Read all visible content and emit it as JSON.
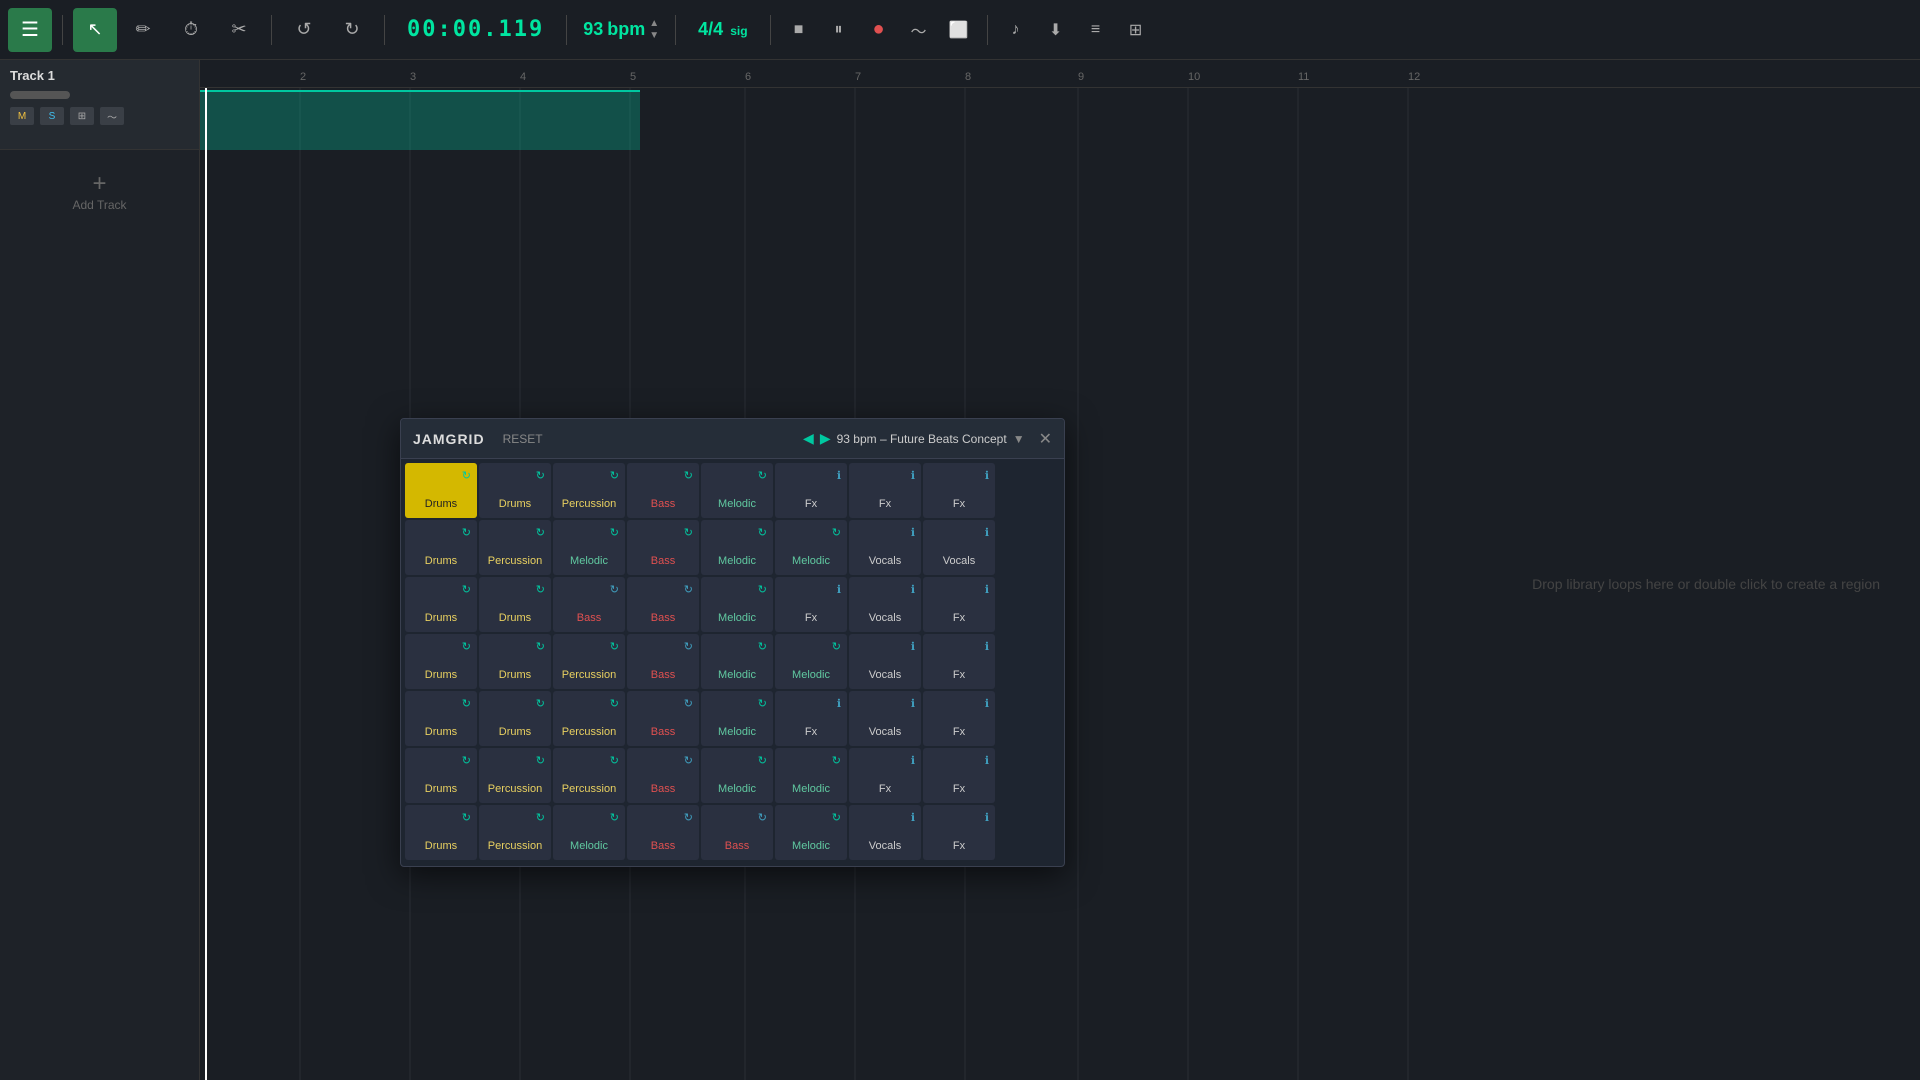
{
  "toolbar": {
    "menu_icon": "☰",
    "cursor_icon": "↖",
    "pencil_icon": "✏",
    "clock_icon": "⏱",
    "scissors_icon": "✂",
    "undo_icon": "↺",
    "redo_icon": "↻",
    "timecode": "00:00.119",
    "bpm_value": "93",
    "bpm_label": "bpm",
    "sig_value": "4/4",
    "sig_label": "sig",
    "stop_icon": "■",
    "play_icon": "⏸",
    "record_icon": "●",
    "waveform_icon": "〜",
    "loop_icon": "⬜",
    "browse_icon": "🎵",
    "import_icon": "⬇",
    "grid_icon": "⊞",
    "effects_icon": "⊞"
  },
  "track_list": {
    "tracks": [
      {
        "name": "Track 1",
        "mute_label": "M",
        "solo_label": "S"
      }
    ],
    "add_track_label": "Add Track"
  },
  "ruler": {
    "marks": [
      "2",
      "3",
      "4",
      "5",
      "6",
      "7",
      "8",
      "9",
      "10",
      "11",
      "12"
    ]
  },
  "drop_hint": "Drop library loops here or double click to create a region",
  "jamgrid": {
    "title": "JAMGRID",
    "reset_label": "RESET",
    "bpm_song": "93 bpm – Future Beats Concept",
    "close_icon": "✕",
    "rows": [
      [
        {
          "label": "Drums",
          "type": "drums",
          "icon_type": "green",
          "active": true
        },
        {
          "label": "Drums",
          "type": "drums",
          "icon_type": "green",
          "active": false
        },
        {
          "label": "Percussion",
          "type": "percussion",
          "icon_type": "green",
          "active": false
        },
        {
          "label": "Bass",
          "type": "bass",
          "icon_type": "green",
          "active": false
        },
        {
          "label": "Melodic",
          "type": "melodic",
          "icon_type": "green",
          "active": false
        },
        {
          "label": "Fx",
          "type": "fx",
          "icon_type": "info",
          "active": false
        },
        {
          "label": "Fx",
          "type": "fx",
          "icon_type": "info",
          "active": false
        },
        {
          "label": "Fx",
          "type": "fx",
          "icon_type": "info",
          "active": false
        }
      ],
      [
        {
          "label": "Drums",
          "type": "drums",
          "icon_type": "green",
          "active": false
        },
        {
          "label": "Percussion",
          "type": "percussion",
          "icon_type": "green",
          "active": false
        },
        {
          "label": "Melodic",
          "type": "melodic",
          "icon_type": "green",
          "active": false
        },
        {
          "label": "Bass",
          "type": "bass",
          "icon_type": "green",
          "active": false
        },
        {
          "label": "Melodic",
          "type": "melodic",
          "icon_type": "green",
          "active": false
        },
        {
          "label": "Melodic",
          "type": "melodic",
          "icon_type": "green",
          "active": false
        },
        {
          "label": "Vocals",
          "type": "vocals",
          "icon_type": "info",
          "active": false
        },
        {
          "label": "Vocals",
          "type": "vocals",
          "icon_type": "info",
          "active": false
        }
      ],
      [
        {
          "label": "Drums",
          "type": "drums",
          "icon_type": "green",
          "active": false
        },
        {
          "label": "Drums",
          "type": "drums",
          "icon_type": "green",
          "active": false
        },
        {
          "label": "Bass",
          "type": "bass",
          "icon_type": "teal",
          "active": false
        },
        {
          "label": "Bass",
          "type": "bass",
          "icon_type": "teal",
          "active": false
        },
        {
          "label": "Melodic",
          "type": "melodic",
          "icon_type": "green",
          "active": false
        },
        {
          "label": "Fx",
          "type": "fx",
          "icon_type": "info",
          "active": false
        },
        {
          "label": "Vocals",
          "type": "vocals",
          "icon_type": "info",
          "active": false
        },
        {
          "label": "Fx",
          "type": "fx",
          "icon_type": "info",
          "active": false
        }
      ],
      [
        {
          "label": "Drums",
          "type": "drums",
          "icon_type": "green",
          "active": false
        },
        {
          "label": "Drums",
          "type": "drums",
          "icon_type": "green",
          "active": false
        },
        {
          "label": "Percussion",
          "type": "percussion",
          "icon_type": "green",
          "active": false
        },
        {
          "label": "Bass",
          "type": "bass",
          "icon_type": "teal",
          "active": false
        },
        {
          "label": "Melodic",
          "type": "melodic",
          "icon_type": "green",
          "active": false
        },
        {
          "label": "Melodic",
          "type": "melodic",
          "icon_type": "green",
          "active": false
        },
        {
          "label": "Vocals",
          "type": "vocals",
          "icon_type": "info",
          "active": false
        },
        {
          "label": "Fx",
          "type": "fx",
          "icon_type": "info",
          "active": false
        }
      ],
      [
        {
          "label": "Drums",
          "type": "drums",
          "icon_type": "green",
          "active": false
        },
        {
          "label": "Drums",
          "type": "drums",
          "icon_type": "green",
          "active": false
        },
        {
          "label": "Percussion",
          "type": "percussion",
          "icon_type": "green",
          "active": false
        },
        {
          "label": "Bass",
          "type": "bass",
          "icon_type": "teal",
          "active": false
        },
        {
          "label": "Melodic",
          "type": "melodic",
          "icon_type": "green",
          "active": false
        },
        {
          "label": "Fx",
          "type": "fx",
          "icon_type": "info",
          "active": false
        },
        {
          "label": "Vocals",
          "type": "vocals",
          "icon_type": "info",
          "active": false
        },
        {
          "label": "Fx",
          "type": "fx",
          "icon_type": "info",
          "active": false
        }
      ],
      [
        {
          "label": "Drums",
          "type": "drums",
          "icon_type": "green",
          "active": false
        },
        {
          "label": "Percussion",
          "type": "percussion",
          "icon_type": "green",
          "active": false
        },
        {
          "label": "Percussion",
          "type": "percussion",
          "icon_type": "green",
          "active": false
        },
        {
          "label": "Bass",
          "type": "bass",
          "icon_type": "teal",
          "active": false
        },
        {
          "label": "Melodic",
          "type": "melodic",
          "icon_type": "green",
          "active": false
        },
        {
          "label": "Melodic",
          "type": "melodic",
          "icon_type": "green",
          "active": false
        },
        {
          "label": "Fx",
          "type": "fx",
          "icon_type": "info",
          "active": false
        },
        {
          "label": "Fx",
          "type": "fx",
          "icon_type": "info",
          "active": false
        }
      ],
      [
        {
          "label": "Drums",
          "type": "drums",
          "icon_type": "green",
          "active": false
        },
        {
          "label": "Percussion",
          "type": "percussion",
          "icon_type": "green",
          "active": false
        },
        {
          "label": "Melodic",
          "type": "melodic",
          "icon_type": "green",
          "active": false
        },
        {
          "label": "Bass",
          "type": "bass",
          "icon_type": "teal",
          "active": false
        },
        {
          "label": "Bass",
          "type": "bass",
          "icon_type": "teal",
          "active": false
        },
        {
          "label": "Melodic",
          "type": "melodic",
          "icon_type": "green",
          "active": false
        },
        {
          "label": "Vocals",
          "type": "vocals",
          "icon_type": "info",
          "active": false
        },
        {
          "label": "Fx",
          "type": "fx",
          "icon_type": "info",
          "active": false
        }
      ]
    ]
  }
}
